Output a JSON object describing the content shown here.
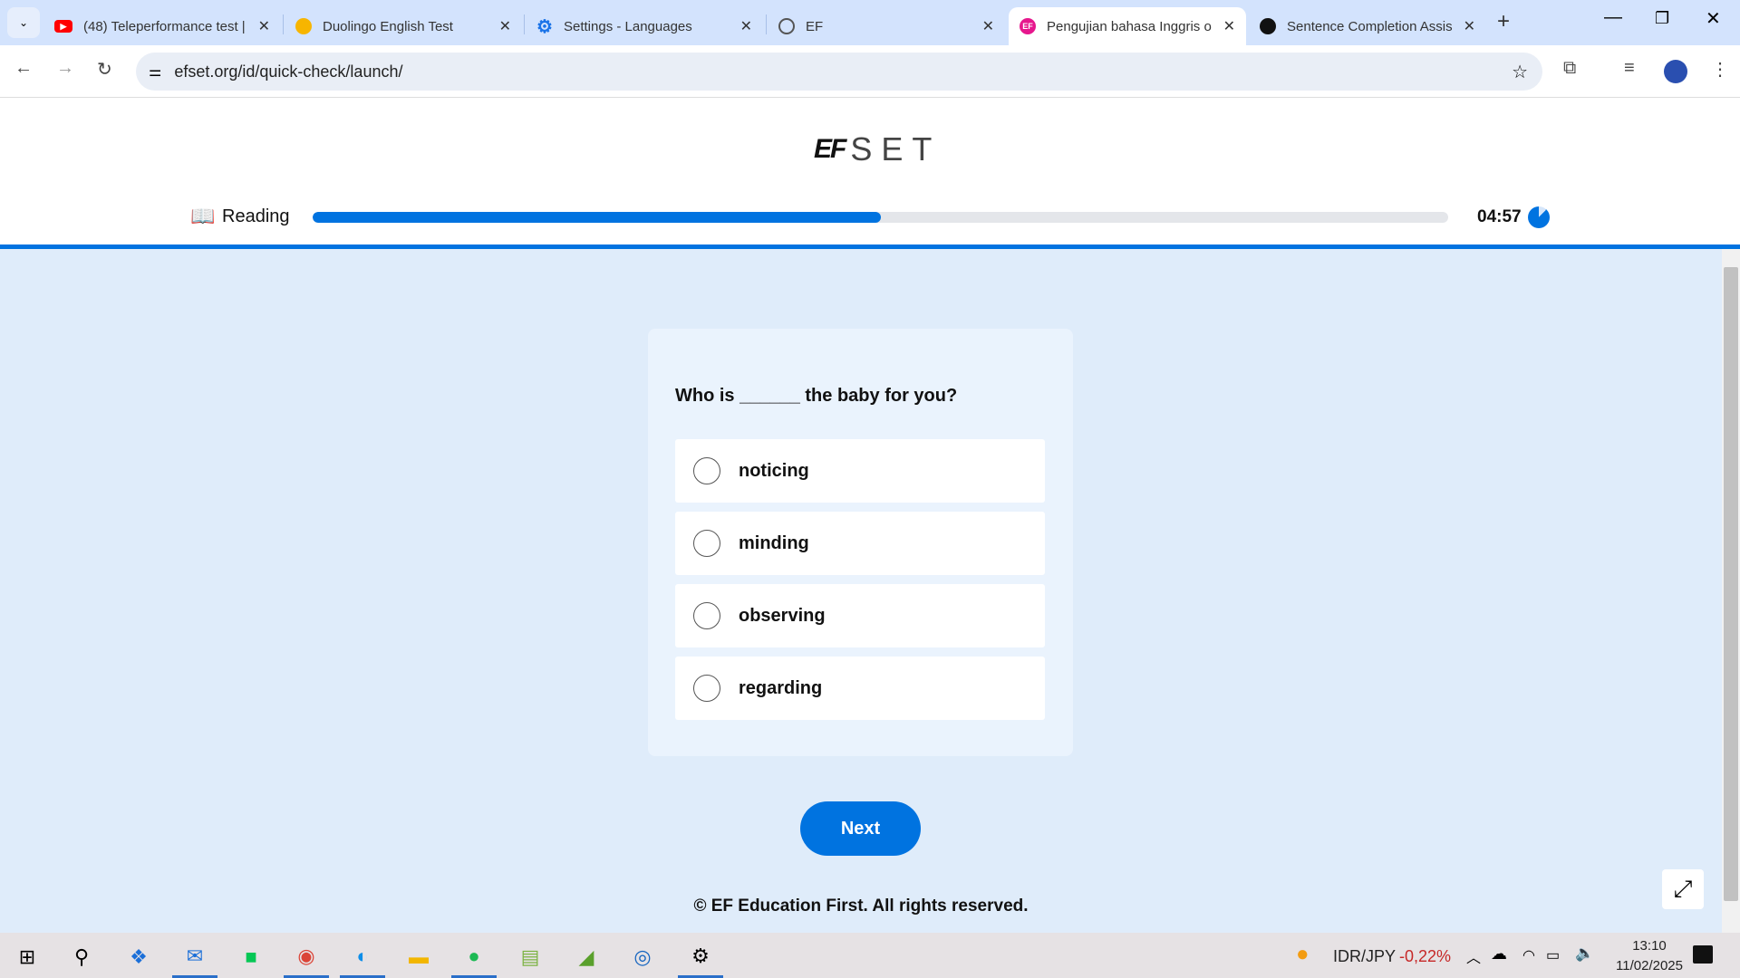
{
  "browser": {
    "tabs": [
      {
        "title": "(48) Teleperformance test |",
        "icon": "youtube-icon",
        "color": "#ff0000"
      },
      {
        "title": "Duolingo English Test",
        "icon": "duolingo-icon",
        "color": "#f7b500"
      },
      {
        "title": "Settings - Languages",
        "icon": "gear-icon",
        "color": "#1a73e8"
      },
      {
        "title": "EF",
        "icon": "globe-icon",
        "color": "#555555"
      },
      {
        "title": "Pengujian bahasa Inggris o",
        "icon": "ef-icon",
        "color": "#e6178d",
        "active": true,
        "fav_text": "EF"
      },
      {
        "title": "Sentence Completion Assis",
        "icon": "chatgpt-icon",
        "color": "#111111"
      }
    ],
    "url": "efset.org/id/quick-check/launch/"
  },
  "header": {
    "logo_mark": "EF",
    "logo_text": "SET",
    "section": "Reading",
    "progress_percent": 50,
    "timer": "04:57"
  },
  "quiz": {
    "question": "Who is ______ the baby for you?",
    "options": [
      "noticing",
      "minding",
      "observing",
      "regarding"
    ],
    "selected": null,
    "next_label": "Next"
  },
  "footer": "© EF Education First. All rights reserved.",
  "colors": {
    "accent": "#0073e0",
    "background": "#dfecfa"
  },
  "taskbar": {
    "ticker": "IDR/JPY",
    "change": "-0,22%",
    "time": "13:10",
    "date": "11/02/2025"
  }
}
